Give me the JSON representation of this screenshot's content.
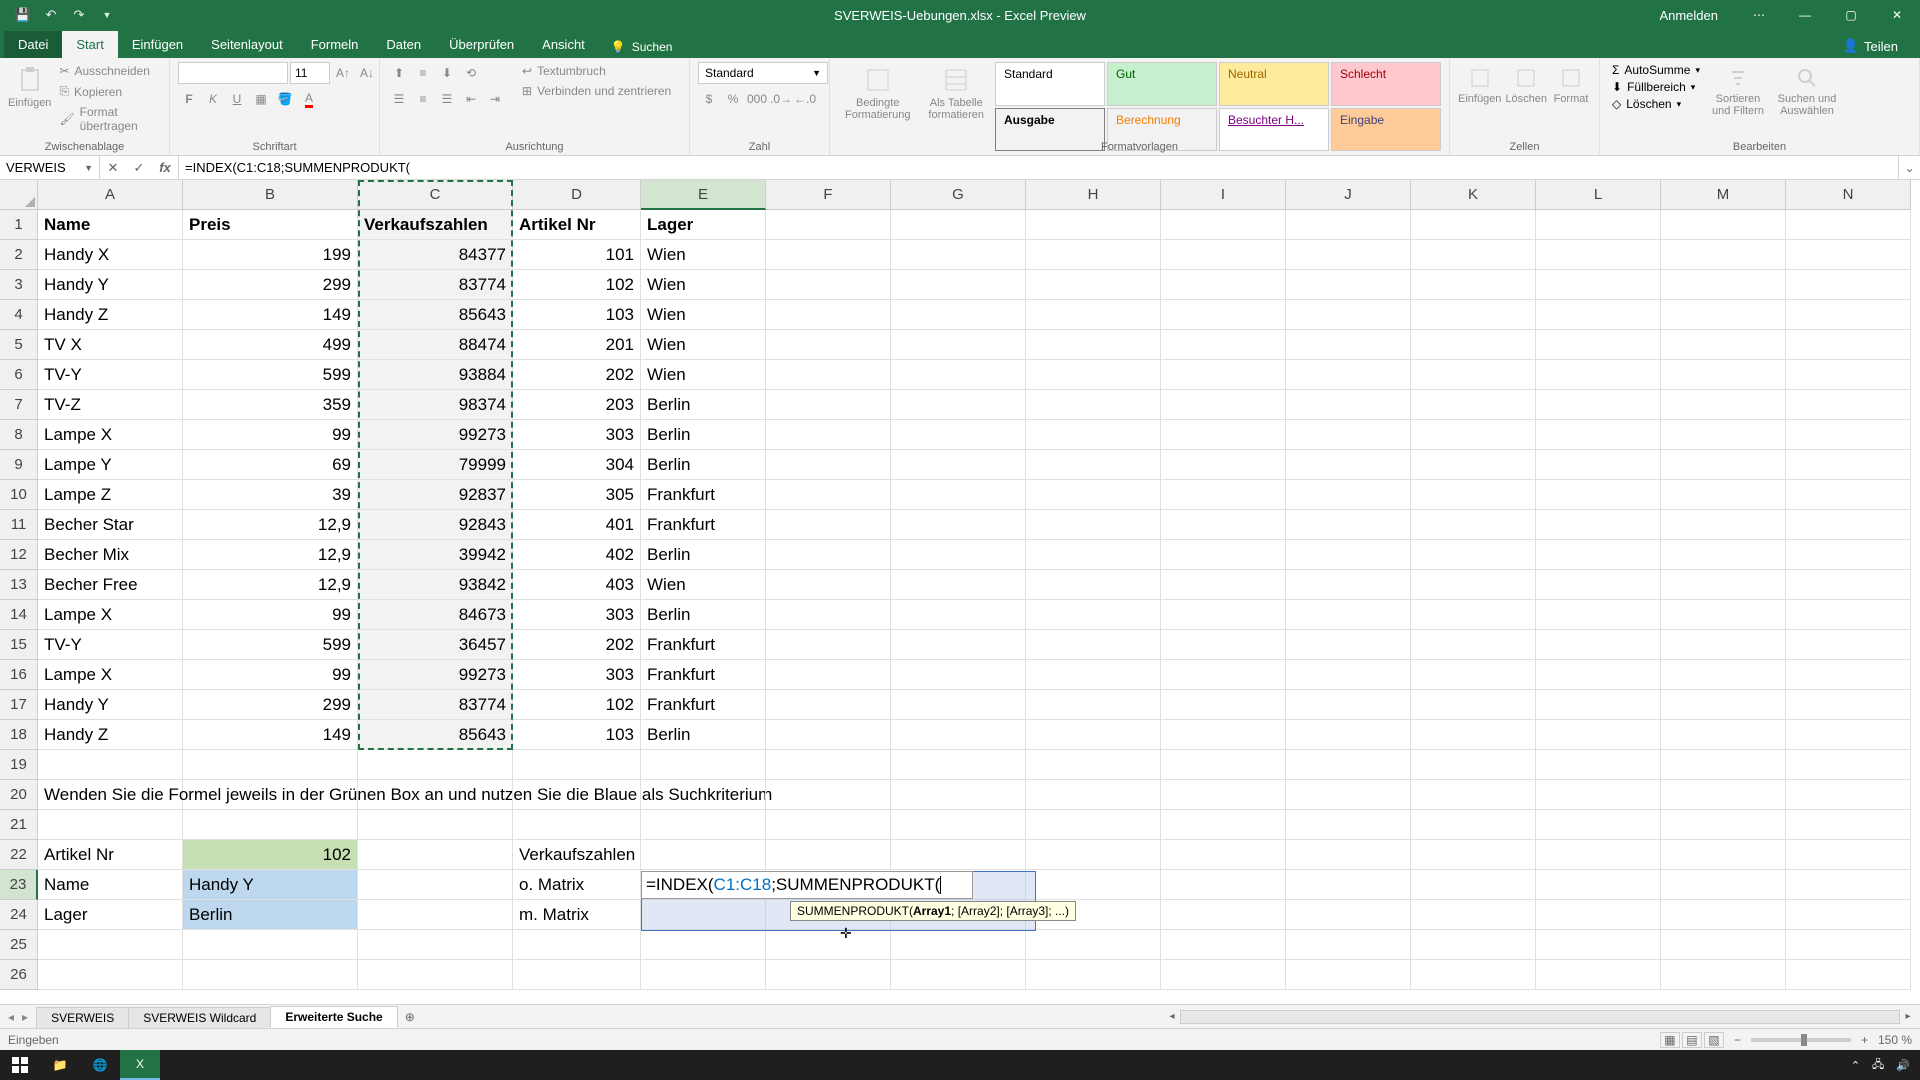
{
  "title": "SVERWEIS-Uebungen.xlsx - Excel Preview",
  "signin": "Anmelden",
  "share": "Teilen",
  "tabs": {
    "file": "Datei",
    "home": "Start",
    "insert": "Einfügen",
    "layout": "Seitenlayout",
    "formulas": "Formeln",
    "data": "Daten",
    "review": "Überprüfen",
    "view": "Ansicht",
    "search": "Suchen"
  },
  "ribbon": {
    "clipboard": {
      "paste": "Einfügen",
      "cut": "Ausschneiden",
      "copy": "Kopieren",
      "format_painter": "Format übertragen",
      "label": "Zwischenablage"
    },
    "font": {
      "name": "",
      "size": "11",
      "label": "Schriftart"
    },
    "alignment": {
      "wrap": "Textumbruch",
      "merge": "Verbinden und zentrieren",
      "label": "Ausrichtung"
    },
    "number": {
      "format": "Standard",
      "label": "Zahl"
    },
    "styles": {
      "cond_fmt": "Bedingte Formatierung",
      "as_table": "Als Tabelle formatieren",
      "s1": "Standard",
      "s2": "Gut",
      "s3": "Neutral",
      "s4": "Schlecht",
      "s5": "Ausgabe",
      "s6": "Berechnung",
      "s7": "Besuchter H...",
      "s8": "Eingabe",
      "label": "Formatvorlagen"
    },
    "cells": {
      "insert": "Einfügen",
      "delete": "Löschen",
      "format": "Format",
      "label": "Zellen"
    },
    "editing": {
      "autosum": "AutoSumme",
      "fill": "Füllbereich",
      "clear": "Löschen",
      "sort": "Sortieren und Filtern",
      "find": "Suchen und Auswählen",
      "label": "Bearbeiten"
    }
  },
  "name_box": "VERWEIS",
  "formula": "=INDEX(C1:C18;SUMMENPRODUKT(",
  "columns": [
    "A",
    "B",
    "C",
    "D",
    "E",
    "F",
    "G",
    "H",
    "I",
    "J",
    "K",
    "L",
    "M",
    "N"
  ],
  "headers": {
    "A": "Name",
    "B": "Preis",
    "C": "Verkaufszahlen",
    "D": "Artikel Nr",
    "E": "Lager"
  },
  "rows": [
    {
      "A": "Handy X",
      "B": "199",
      "C": "84377",
      "D": "101",
      "E": "Wien"
    },
    {
      "A": "Handy Y",
      "B": "299",
      "C": "83774",
      "D": "102",
      "E": "Wien"
    },
    {
      "A": "Handy Z",
      "B": "149",
      "C": "85643",
      "D": "103",
      "E": "Wien"
    },
    {
      "A": "TV X",
      "B": "499",
      "C": "88474",
      "D": "201",
      "E": "Wien"
    },
    {
      "A": "TV-Y",
      "B": "599",
      "C": "93884",
      "D": "202",
      "E": "Wien"
    },
    {
      "A": "TV-Z",
      "B": "359",
      "C": "98374",
      "D": "203",
      "E": "Berlin"
    },
    {
      "A": "Lampe X",
      "B": "99",
      "C": "99273",
      "D": "303",
      "E": "Berlin"
    },
    {
      "A": "Lampe Y",
      "B": "69",
      "C": "79999",
      "D": "304",
      "E": "Berlin"
    },
    {
      "A": "Lampe Z",
      "B": "39",
      "C": "92837",
      "D": "305",
      "E": "Frankfurt"
    },
    {
      "A": "Becher Star",
      "B": "12,9",
      "C": "92843",
      "D": "401",
      "E": "Frankfurt"
    },
    {
      "A": "Becher Mix",
      "B": "12,9",
      "C": "39942",
      "D": "402",
      "E": "Berlin"
    },
    {
      "A": "Becher Free",
      "B": "12,9",
      "C": "93842",
      "D": "403",
      "E": "Wien"
    },
    {
      "A": "Lampe X",
      "B": "99",
      "C": "84673",
      "D": "303",
      "E": "Berlin"
    },
    {
      "A": "TV-Y",
      "B": "599",
      "C": "36457",
      "D": "202",
      "E": "Frankfurt"
    },
    {
      "A": "Lampe X",
      "B": "99",
      "C": "99273",
      "D": "303",
      "E": "Frankfurt"
    },
    {
      "A": "Handy Y",
      "B": "299",
      "C": "83774",
      "D": "102",
      "E": "Frankfurt"
    },
    {
      "A": "Handy Z",
      "B": "149",
      "C": "85643",
      "D": "103",
      "E": "Berlin"
    }
  ],
  "row20": "Wenden Sie die Formel jeweils in der Grünen Box an und nutzen Sie die Blaue als Suchkriterium",
  "block": {
    "A22": "Artikel Nr",
    "B22": "102",
    "A23": "Name",
    "B23": "Handy Y",
    "A24": "Lager",
    "B24": "Berlin",
    "D22": "Verkaufszahlen",
    "D23": "o. Matrix",
    "D24": "m. Matrix"
  },
  "editing_cell_text": "=INDEX(C1:C18;SUMMENPRODUKT(",
  "tooltip": {
    "fn": "SUMMENPRODUKT(",
    "a1": "Array1",
    "rest": "; [Array2]; [Array3]; ...)"
  },
  "sheets": {
    "s1": "SVERWEIS",
    "s2": "SVERWEIS Wildcard",
    "s3": "Erweiterte Suche"
  },
  "status": "Eingeben",
  "zoom": "150 %"
}
